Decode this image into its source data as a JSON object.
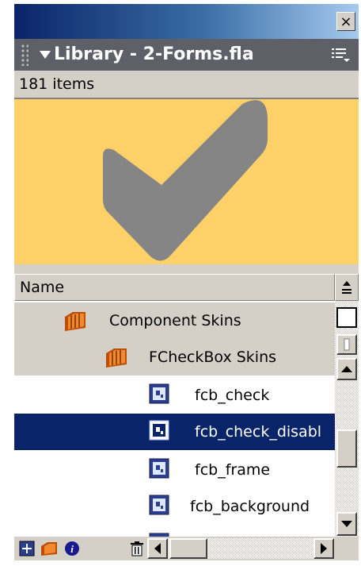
{
  "panel": {
    "title": "Library - 2-Forms.fla",
    "item_count": "181 items"
  },
  "list": {
    "column_header": "Name",
    "rows": [
      {
        "label": "Component Skins",
        "type": "folder"
      },
      {
        "label": "FCheckBox Skins",
        "type": "folder"
      },
      {
        "label": "fcb_check",
        "type": "movie-clip"
      },
      {
        "label": "fcb_check_disabl",
        "type": "movie-clip",
        "selected": true
      },
      {
        "label": "fcb_frame",
        "type": "movie-clip"
      },
      {
        "label": "fcb_background",
        "type": "movie-clip"
      }
    ]
  },
  "colors": {
    "preview_bg": "#ffd168",
    "checkmark": "#858585",
    "selection": "#0a246a",
    "panel_header": "#5f6067"
  },
  "icons": [
    "close-icon",
    "options-menu-icon",
    "new-symbol-icon",
    "new-folder-icon",
    "properties-icon",
    "delete-icon",
    "folder-icon",
    "movie-clip-icon"
  ]
}
